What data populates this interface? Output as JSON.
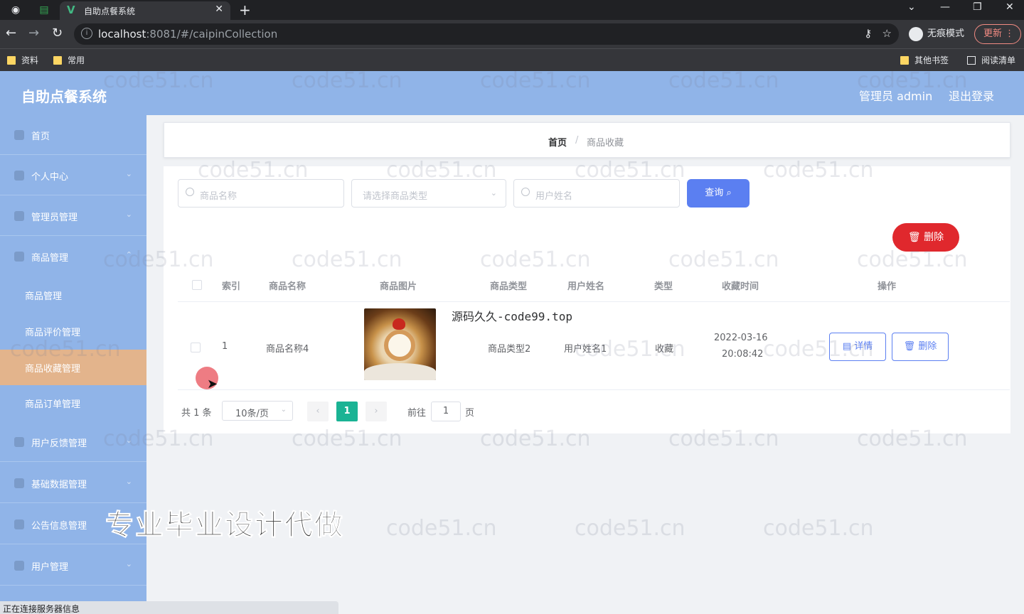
{
  "browser": {
    "tab_title": "自助点餐系统",
    "url_host": "localhost",
    "url_rest": ":8081/#/caipinCollection",
    "incognito_label": "无痕模式",
    "update_label": "更新",
    "bookmarks": [
      "资料",
      "常用"
    ],
    "other_bookmarks": "其他书签",
    "reading_list": "阅读清单",
    "status_text": "正在连接服务器信息"
  },
  "header": {
    "title": "自助点餐系统",
    "user": "管理员 admin",
    "logout": "退出登录"
  },
  "sidebar": {
    "items": [
      {
        "label": "首页"
      },
      {
        "label": "个人中心"
      },
      {
        "label": "管理员管理"
      },
      {
        "label": "商品管理"
      },
      {
        "label": "用户反馈管理"
      },
      {
        "label": "基础数据管理"
      },
      {
        "label": "公告信息管理"
      },
      {
        "label": "用户管理"
      }
    ],
    "sub_items": [
      {
        "label": "商品管理"
      },
      {
        "label": "商品评价管理"
      },
      {
        "label": "商品收藏管理"
      },
      {
        "label": "商品订单管理"
      }
    ]
  },
  "breadcrumb": {
    "home": "首页",
    "separator": "/",
    "current": "商品收藏"
  },
  "search": {
    "product_name_placeholder": "商品名称",
    "product_type_placeholder": "请选择商品类型",
    "user_name_placeholder": "用户姓名",
    "query_label": "查询",
    "delete_label": "删除"
  },
  "table": {
    "headers": [
      "索引",
      "商品名称",
      "商品图片",
      "商品类型",
      "用户姓名",
      "类型",
      "收藏时间",
      "操作"
    ],
    "rows": [
      {
        "index": "1",
        "name": "商品名称4",
        "type": "商品类型2",
        "user": "用户姓名1",
        "kind": "收藏",
        "date": "2022-03-16",
        "time": "20:08:42",
        "detail_label": "详情",
        "delete_label": "删除"
      }
    ]
  },
  "pagination": {
    "total": "共 1 条",
    "page_size": "10条/页",
    "prev": "‹",
    "current": "1",
    "next": "›",
    "goto_label": "前往",
    "goto_value": "1",
    "page_suffix": "页"
  },
  "overlays": {
    "watermark": "code51.cn",
    "source_text": "源码久久-code99.top",
    "promo": "专业毕业设计代做"
  },
  "colors": {
    "header_bg": "#90b4e8",
    "active_menu": "#e3b48c",
    "primary": "#5b7ff1",
    "danger": "#e0282d",
    "pager_active": "#1ab394"
  }
}
